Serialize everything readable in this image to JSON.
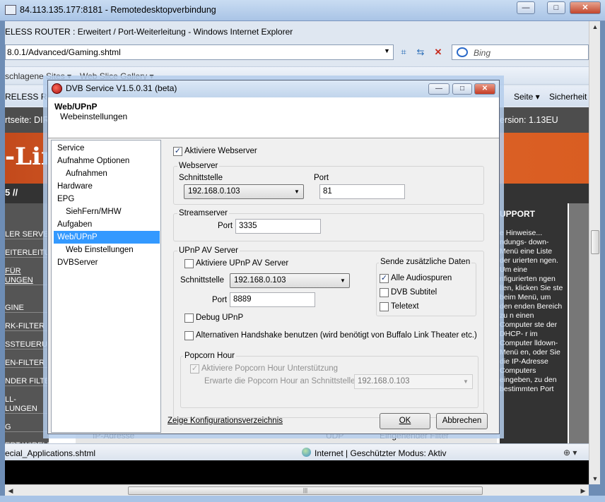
{
  "rdp": {
    "title": "84.113.135.177:8181 - Remotedesktopverbindung",
    "min": "—",
    "max": "□",
    "close": "✕"
  },
  "ie": {
    "title": "ELESS ROUTER : Erweitert / Port-Weiterleitung - Windows Internet Explorer",
    "address": "8.0.1/Advanced/Gaming.shtml",
    "search_placeholder": "Bing",
    "fav_sites": "schlagene Sites ▾",
    "fav_gallery": "Web Slice Gallery ▾",
    "tab_title": "RELESS ROU",
    "seite": "Seite ▾",
    "sicherheit": "Sicherheit",
    "status_url": "ecial_Applications.shtml",
    "status_zone": "Internet | Geschützter Modus: Aktiv",
    "zoom": "⊕ ▾"
  },
  "webpage": {
    "startseite": "rtseite: DIR",
    "version": "ersion: 1.13EU",
    "logo": "-Lin",
    "model": "5 //",
    "nav": [
      "LER SERVER",
      "EITERLEITUN",
      "FÜR",
      "UNGEN",
      "GINE",
      "RK-FILTER",
      "SSTEUERUN",
      "EN-FILTER",
      "NDER FILTE",
      "LL-",
      "LUNGEN",
      "G",
      "ERT WIRELE"
    ],
    "support_head": "UPPORT",
    "support_text": "e Hinweise... ndungs- down-Menü eine Liste der urierten ngen. Um eine nfigurierten ngen llen, klicken Sie ste beim Menü, um den enden Bereich zu n einen Computer ste der DHCP- r im Computer lldown-Menü en, oder Sie die IP-Adresse Computers eingeben, zu den bestimmten Port",
    "table_ip": "IP-Adresse",
    "table_udp": "UDP",
    "table_filter": "Eingehender Filter"
  },
  "dialog": {
    "title": "DVB Service V1.5.0.31 (beta)",
    "header_title": "Web/UPnP",
    "header_sub": "Webeinstellungen",
    "tree": [
      {
        "label": "Service",
        "indent": 0
      },
      {
        "label": "Aufnahme Optionen",
        "indent": 0
      },
      {
        "label": "Aufnahmen",
        "indent": 1
      },
      {
        "label": "Hardware",
        "indent": 0
      },
      {
        "label": "EPG",
        "indent": 0
      },
      {
        "label": "SiehFern/MHW",
        "indent": 1
      },
      {
        "label": "Aufgaben",
        "indent": 0
      },
      {
        "label": "Web/UPnP",
        "indent": 0,
        "selected": true
      },
      {
        "label": "Web Einstellungen",
        "indent": 1
      },
      {
        "label": "DVBServer",
        "indent": 0
      }
    ],
    "activate_webserver": "Aktiviere Webserver",
    "webserver_group": "Webserver",
    "interface_label": "Schnittstelle",
    "port_label": "Port",
    "web_interface": "192.168.0.103",
    "web_port": "81",
    "streamserver_group": "Streamserver",
    "stream_port_label": "Port",
    "stream_port": "3335",
    "upnp_group": "UPnP AV Server",
    "activate_upnp": "Aktiviere UPnP AV Server",
    "upnp_interface_label": "Schnittstelle",
    "upnp_interface": "192.168.0.103",
    "upnp_port_label": "Port",
    "upnp_port": "8889",
    "debug_upnp": "Debug UPnP",
    "alt_handshake": "Alternativen Handshake benutzen (wird benötigt von Buffalo Link Theater etc.)",
    "extra_group": "Sende zusätzliche Daten",
    "all_audio": "Alle Audiospuren",
    "dvb_subtitle": "DVB Subtitel",
    "teletext": "Teletext",
    "popcorn_group": "Popcorn Hour",
    "popcorn_activate": "Aktiviere Popcorn Hour Unterstützung",
    "popcorn_expect": "Erwarte die Popcorn Hour an Schnittstelle",
    "popcorn_interface": "192.168.0.103",
    "config_link": "Zeige Konfigurationsverzeichnis",
    "ok": "OK",
    "cancel": "Abbrechen"
  }
}
